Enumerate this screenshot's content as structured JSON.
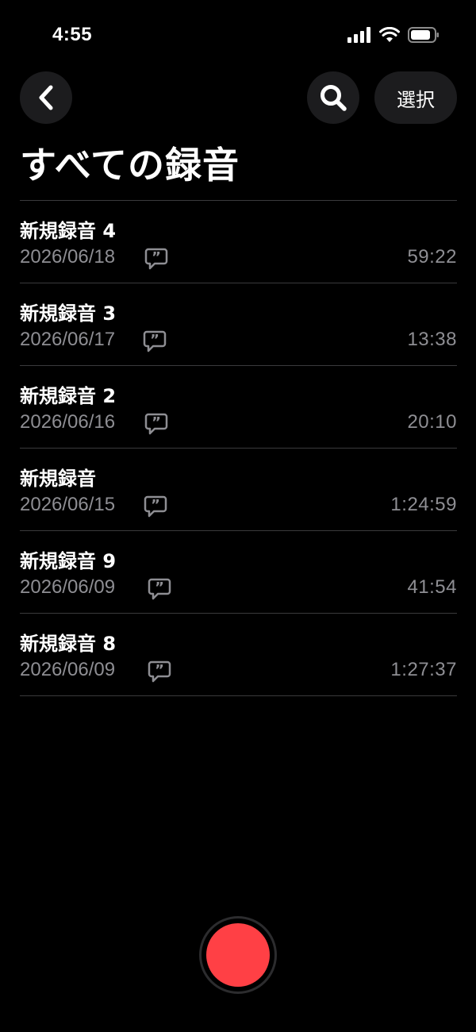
{
  "status_bar": {
    "time": "4:55",
    "icons": [
      "cellular-signal-icon",
      "wifi-icon",
      "battery-icon"
    ]
  },
  "toolbar": {
    "back_icon": "chevron-left-icon",
    "search_icon": "search-icon",
    "select_label": "選択"
  },
  "page": {
    "title": "すべての録音"
  },
  "recordings": [
    {
      "title": "新規録音 4",
      "date": "2026/06/18",
      "duration": "59:22"
    },
    {
      "title": "新規録音 3",
      "date": "2026/06/17",
      "duration": "13:38"
    },
    {
      "title": "新規録音 2",
      "date": "2026/06/16",
      "duration": "20:10"
    },
    {
      "title": "新規録音",
      "date": "2026/06/15",
      "duration": "1:24:59"
    },
    {
      "title": "新規録音 9",
      "date": "2026/06/09",
      "duration": "41:54"
    },
    {
      "title": "新規録音 8",
      "date": "2026/06/09",
      "duration": "1:27:37"
    }
  ],
  "colors": {
    "background": "#000000",
    "button_bg": "#1c1c1e",
    "secondary_text": "#8e8e93",
    "divider": "#3a3a3c",
    "record": "#ff4045"
  },
  "record_button": {
    "icon": "record-icon"
  }
}
